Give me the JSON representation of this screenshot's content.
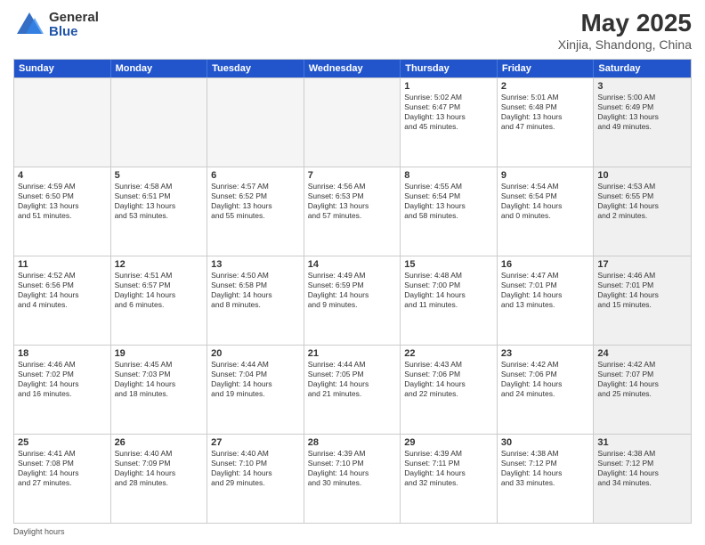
{
  "logo": {
    "general": "General",
    "blue": "Blue"
  },
  "title": "May 2025",
  "subtitle": "Xinjia, Shandong, China",
  "days": [
    "Sunday",
    "Monday",
    "Tuesday",
    "Wednesday",
    "Thursday",
    "Friday",
    "Saturday"
  ],
  "weeks": [
    [
      {
        "day": "",
        "content": "",
        "empty": true
      },
      {
        "day": "",
        "content": "",
        "empty": true
      },
      {
        "day": "",
        "content": "",
        "empty": true
      },
      {
        "day": "",
        "content": "",
        "empty": true
      },
      {
        "day": "1",
        "content": "Sunrise: 5:02 AM\nSunset: 6:47 PM\nDaylight: 13 hours\nand 45 minutes.",
        "empty": false
      },
      {
        "day": "2",
        "content": "Sunrise: 5:01 AM\nSunset: 6:48 PM\nDaylight: 13 hours\nand 47 minutes.",
        "empty": false
      },
      {
        "day": "3",
        "content": "Sunrise: 5:00 AM\nSunset: 6:49 PM\nDaylight: 13 hours\nand 49 minutes.",
        "empty": false,
        "shaded": true
      }
    ],
    [
      {
        "day": "4",
        "content": "Sunrise: 4:59 AM\nSunset: 6:50 PM\nDaylight: 13 hours\nand 51 minutes.",
        "empty": false
      },
      {
        "day": "5",
        "content": "Sunrise: 4:58 AM\nSunset: 6:51 PM\nDaylight: 13 hours\nand 53 minutes.",
        "empty": false
      },
      {
        "day": "6",
        "content": "Sunrise: 4:57 AM\nSunset: 6:52 PM\nDaylight: 13 hours\nand 55 minutes.",
        "empty": false
      },
      {
        "day": "7",
        "content": "Sunrise: 4:56 AM\nSunset: 6:53 PM\nDaylight: 13 hours\nand 57 minutes.",
        "empty": false
      },
      {
        "day": "8",
        "content": "Sunrise: 4:55 AM\nSunset: 6:54 PM\nDaylight: 13 hours\nand 58 minutes.",
        "empty": false
      },
      {
        "day": "9",
        "content": "Sunrise: 4:54 AM\nSunset: 6:54 PM\nDaylight: 14 hours\nand 0 minutes.",
        "empty": false
      },
      {
        "day": "10",
        "content": "Sunrise: 4:53 AM\nSunset: 6:55 PM\nDaylight: 14 hours\nand 2 minutes.",
        "empty": false,
        "shaded": true
      }
    ],
    [
      {
        "day": "11",
        "content": "Sunrise: 4:52 AM\nSunset: 6:56 PM\nDaylight: 14 hours\nand 4 minutes.",
        "empty": false
      },
      {
        "day": "12",
        "content": "Sunrise: 4:51 AM\nSunset: 6:57 PM\nDaylight: 14 hours\nand 6 minutes.",
        "empty": false
      },
      {
        "day": "13",
        "content": "Sunrise: 4:50 AM\nSunset: 6:58 PM\nDaylight: 14 hours\nand 8 minutes.",
        "empty": false
      },
      {
        "day": "14",
        "content": "Sunrise: 4:49 AM\nSunset: 6:59 PM\nDaylight: 14 hours\nand 9 minutes.",
        "empty": false
      },
      {
        "day": "15",
        "content": "Sunrise: 4:48 AM\nSunset: 7:00 PM\nDaylight: 14 hours\nand 11 minutes.",
        "empty": false
      },
      {
        "day": "16",
        "content": "Sunrise: 4:47 AM\nSunset: 7:01 PM\nDaylight: 14 hours\nand 13 minutes.",
        "empty": false
      },
      {
        "day": "17",
        "content": "Sunrise: 4:46 AM\nSunset: 7:01 PM\nDaylight: 14 hours\nand 15 minutes.",
        "empty": false,
        "shaded": true
      }
    ],
    [
      {
        "day": "18",
        "content": "Sunrise: 4:46 AM\nSunset: 7:02 PM\nDaylight: 14 hours\nand 16 minutes.",
        "empty": false
      },
      {
        "day": "19",
        "content": "Sunrise: 4:45 AM\nSunset: 7:03 PM\nDaylight: 14 hours\nand 18 minutes.",
        "empty": false
      },
      {
        "day": "20",
        "content": "Sunrise: 4:44 AM\nSunset: 7:04 PM\nDaylight: 14 hours\nand 19 minutes.",
        "empty": false
      },
      {
        "day": "21",
        "content": "Sunrise: 4:44 AM\nSunset: 7:05 PM\nDaylight: 14 hours\nand 21 minutes.",
        "empty": false
      },
      {
        "day": "22",
        "content": "Sunrise: 4:43 AM\nSunset: 7:06 PM\nDaylight: 14 hours\nand 22 minutes.",
        "empty": false
      },
      {
        "day": "23",
        "content": "Sunrise: 4:42 AM\nSunset: 7:06 PM\nDaylight: 14 hours\nand 24 minutes.",
        "empty": false
      },
      {
        "day": "24",
        "content": "Sunrise: 4:42 AM\nSunset: 7:07 PM\nDaylight: 14 hours\nand 25 minutes.",
        "empty": false,
        "shaded": true
      }
    ],
    [
      {
        "day": "25",
        "content": "Sunrise: 4:41 AM\nSunset: 7:08 PM\nDaylight: 14 hours\nand 27 minutes.",
        "empty": false
      },
      {
        "day": "26",
        "content": "Sunrise: 4:40 AM\nSunset: 7:09 PM\nDaylight: 14 hours\nand 28 minutes.",
        "empty": false
      },
      {
        "day": "27",
        "content": "Sunrise: 4:40 AM\nSunset: 7:10 PM\nDaylight: 14 hours\nand 29 minutes.",
        "empty": false
      },
      {
        "day": "28",
        "content": "Sunrise: 4:39 AM\nSunset: 7:10 PM\nDaylight: 14 hours\nand 30 minutes.",
        "empty": false
      },
      {
        "day": "29",
        "content": "Sunrise: 4:39 AM\nSunset: 7:11 PM\nDaylight: 14 hours\nand 32 minutes.",
        "empty": false
      },
      {
        "day": "30",
        "content": "Sunrise: 4:38 AM\nSunset: 7:12 PM\nDaylight: 14 hours\nand 33 minutes.",
        "empty": false
      },
      {
        "day": "31",
        "content": "Sunrise: 4:38 AM\nSunset: 7:12 PM\nDaylight: 14 hours\nand 34 minutes.",
        "empty": false,
        "shaded": true
      }
    ]
  ],
  "footer": "Daylight hours"
}
